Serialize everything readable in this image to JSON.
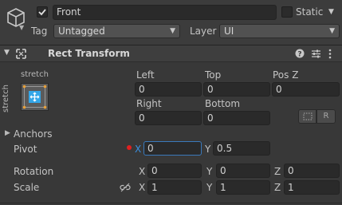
{
  "go": {
    "icon": "cube-icon",
    "name": "Front",
    "static_label": "Static",
    "tag_label": "Tag",
    "tag_value": "Untagged",
    "layer_label": "Layer",
    "layer_value": "UI"
  },
  "rect": {
    "title": "Rect Transform",
    "anchor_top_text": "stretch",
    "anchor_side_text": "stretch",
    "col_left": "Left",
    "col_top": "Top",
    "col_posz": "Pos Z",
    "left": "0",
    "top": "0",
    "posz": "0",
    "col_right": "Right",
    "col_bottom": "Bottom",
    "right": "0",
    "bottom": "0",
    "r_button": "R",
    "anchors_label": "Anchors",
    "pivot_label": "Pivot",
    "pivot_x_label": "X",
    "pivot_x": "0",
    "pivot_y_label": "Y",
    "pivot_y": "0.5",
    "rotation_label": "Rotation",
    "rot_x_label": "X",
    "rot_x": "0",
    "rot_y_label": "Y",
    "rot_y": "0",
    "rot_z_label": "Z",
    "rot_z": "0",
    "scale_label": "Scale",
    "scale_x_label": "X",
    "scale_x": "1",
    "scale_y_label": "Y",
    "scale_y": "1",
    "scale_z_label": "Z",
    "scale_z": "1"
  },
  "colors": {
    "background": "#383838",
    "field": "#2a2a2a",
    "focus": "#3a79bb",
    "anchor_blue": "#33a6e8",
    "anchor_orange": "#e8a03a",
    "pivot_marker": "#e02020"
  }
}
